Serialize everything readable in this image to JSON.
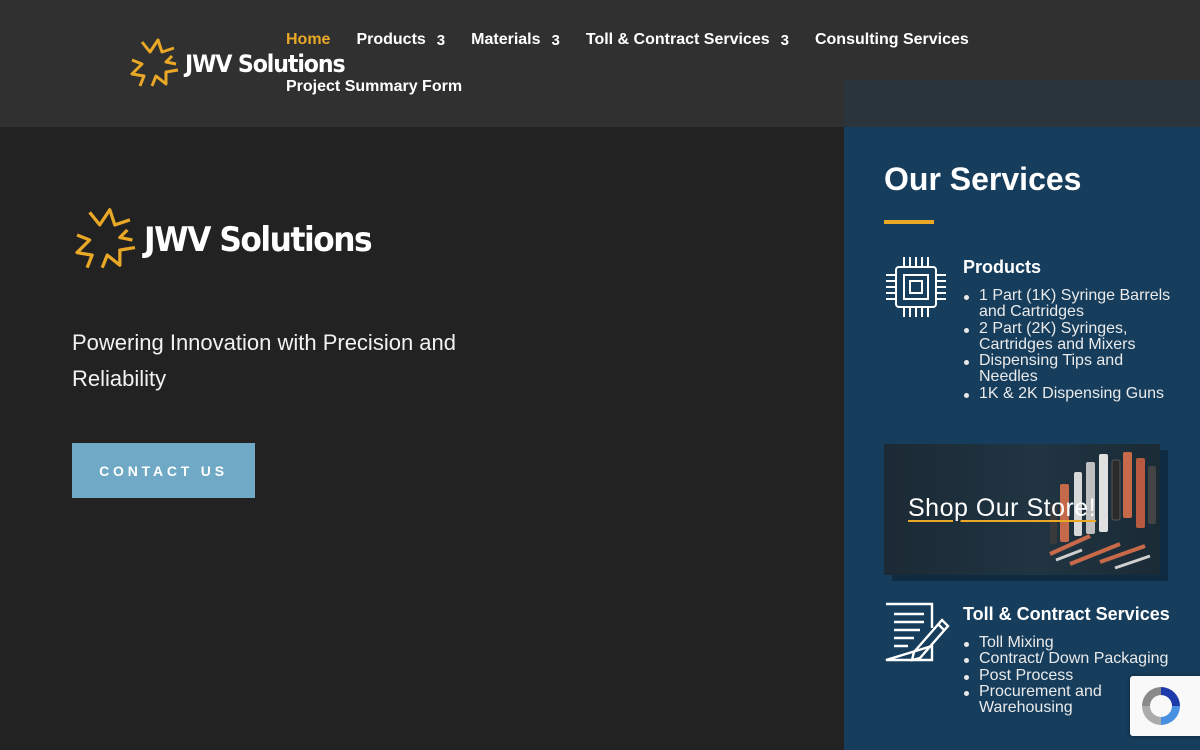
{
  "brand": {
    "name": "JWV Solutions",
    "accent": "#e9a825"
  },
  "nav": {
    "items": [
      {
        "label": "Home",
        "caret": ""
      },
      {
        "label": "Products",
        "caret": "3"
      },
      {
        "label": "Materials",
        "caret": "3"
      },
      {
        "label": "Toll & Contract Services",
        "caret": "3"
      },
      {
        "label": "Consulting Services",
        "caret": ""
      },
      {
        "label": "Project Summary Form",
        "caret": ""
      }
    ]
  },
  "hero": {
    "tagline": "Powering Innovation with Precision and Reliability",
    "cta_label": "CONTACT US"
  },
  "sidebar": {
    "title": "Our Services",
    "products": {
      "heading": "Products",
      "icon": "chip-icon",
      "items": [
        "1 Part (1K) Syringe Barrels and Cartridges",
        "2 Part (2K) Syringes, Cartridges and Mixers",
        "Dispensing Tips and Needles",
        "1K & 2K Dispensing Guns"
      ]
    },
    "store": {
      "label": "Shop Our Store!"
    },
    "toll": {
      "heading": "Toll & Contract Services",
      "icon": "document-pen-icon",
      "items": [
        "Toll Mixing",
        "Contract/ Down Packaging",
        "Post Process",
        "Procurement and Warehousing"
      ]
    }
  },
  "colors": {
    "header_bg": "#303030",
    "body_bg": "#222222",
    "sidebar_bg": "#163d5c",
    "cta_bg": "#6fa9c6"
  }
}
